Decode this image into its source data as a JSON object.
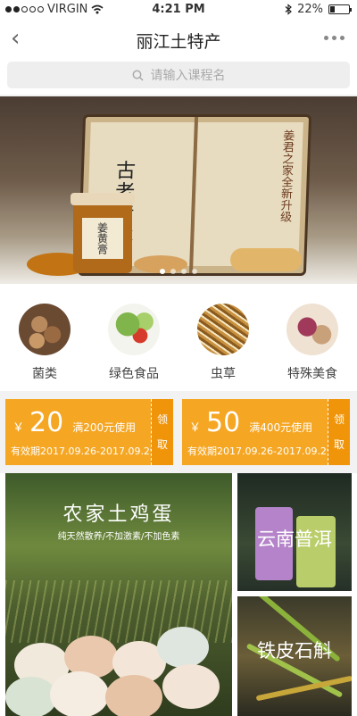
{
  "status_bar": {
    "carrier": "VIRGIN",
    "time": "4:21 PM",
    "battery": "22%"
  },
  "nav": {
    "title": "丽江土特产"
  },
  "search": {
    "placeholder": "请输入课程名"
  },
  "banner": {
    "calligraphy": "古老传承",
    "book_text": "姜君之家全新升级",
    "jar_label": "姜黄膏",
    "slides": 4,
    "active_slide": 1
  },
  "categories": [
    {
      "label": "菌类",
      "icon": "mushroom-icon"
    },
    {
      "label": "绿色食品",
      "icon": "vegetable-icon"
    },
    {
      "label": "虫草",
      "icon": "cordyceps-icon"
    },
    {
      "label": "特殊美食",
      "icon": "snack-icon"
    }
  ],
  "coupons": [
    {
      "symbol": "￥",
      "amount": "20",
      "condition": "满200元使用",
      "validity": "有效期2017.09.26-2017.09.29",
      "claim_top": "领",
      "claim_bottom": "取"
    },
    {
      "symbol": "￥",
      "amount": "50",
      "condition": "满400元使用",
      "validity": "有效期2017.09.26-2017.09.29",
      "claim_top": "领",
      "claim_bottom": "取"
    }
  ],
  "features": {
    "eggs": {
      "title": "农家土鸡蛋",
      "subtitle": "纯天然散养/不加激素/不加色素"
    },
    "tea": {
      "title": "云南普洱"
    },
    "dendrobium": {
      "title": "铁皮石斛"
    }
  },
  "colors": {
    "accent": "#f5a623",
    "accent_dark": "#f0950a"
  }
}
